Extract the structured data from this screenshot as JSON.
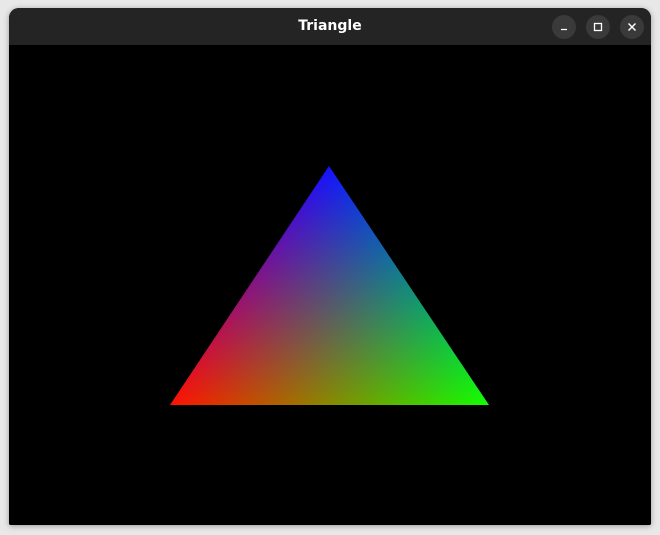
{
  "window": {
    "title": "Triangle",
    "controls": [
      "minimize",
      "maximize",
      "close"
    ]
  },
  "scene": {
    "background_color": "#000000",
    "vertices": [
      {
        "name": "top",
        "color": "#0000ff"
      },
      {
        "name": "bottom-left",
        "color": "#ff0000"
      },
      {
        "name": "bottom-right",
        "color": "#00ff00"
      }
    ]
  }
}
